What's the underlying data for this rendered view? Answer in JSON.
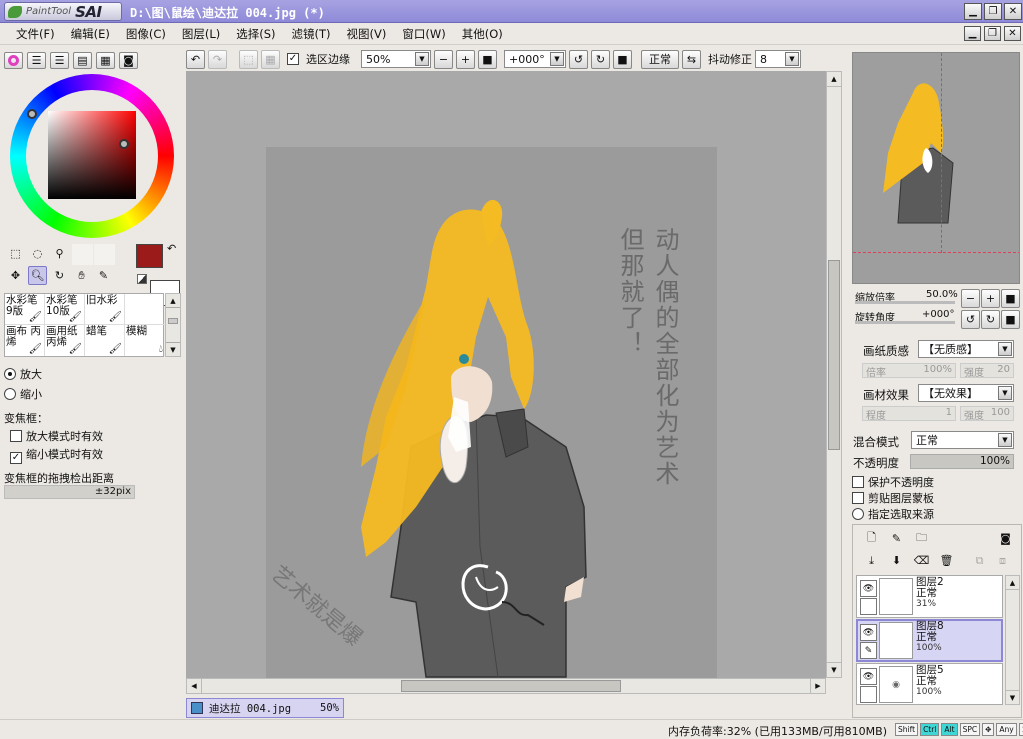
{
  "titlebar": {
    "logo_small": "PaintTool",
    "logo_big": "SAI",
    "document": "D:\\图\\鼠绘\\迪达拉 004.jpg (*)"
  },
  "menu": [
    {
      "label": "文件(F)"
    },
    {
      "label": "编辑(E)"
    },
    {
      "label": "图像(C)"
    },
    {
      "label": "图层(L)"
    },
    {
      "label": "选择(S)"
    },
    {
      "label": "滤镜(T)"
    },
    {
      "label": "视图(V)"
    },
    {
      "label": "窗口(W)"
    },
    {
      "label": "其他(O)"
    }
  ],
  "toolbar": {
    "selection_edge_label": "选区边缘",
    "zoom": "50%",
    "rotation": "+000°",
    "blend": "正常",
    "stabilizer_label": "抖动修正",
    "stabilizer": "8"
  },
  "colors": {
    "primary": "#9b1b1b",
    "secondary": "#ffffff",
    "canvas_bg": "#a9a9a9",
    "paper": "#9b9b9b",
    "hair": "#f5bb22"
  },
  "brushes": [
    {
      "label": "水彩笔 9版"
    },
    {
      "label": "水彩笔 10版"
    },
    {
      "label": "旧水彩"
    },
    {
      "label": ""
    },
    {
      "label": "画布 丙烯"
    },
    {
      "label": "画用纸 丙烯"
    },
    {
      "label": "蜡笔"
    },
    {
      "label": "模糊"
    }
  ],
  "zoom_tool": {
    "zoom_in": "放大",
    "zoom_out": "缩小",
    "frame_label": "变焦框：",
    "opt_in": "放大模式时有效",
    "opt_out": "缩小模式时有效",
    "drag_label": "变焦框的拖拽检出距离",
    "drag_value": "±32pix"
  },
  "artwork_text": {
    "col1": "动人偶的全部化为艺术",
    "col2": "但那就了！",
    "signature": "艺术就是爆"
  },
  "navigator": {
    "zoom_label": "缩放倍率",
    "zoom_value": "50.0%",
    "rotate_label": "旋转角度",
    "rotate_value": "+000°"
  },
  "paper_texture": {
    "label": "画纸质感",
    "value": "【无质感】",
    "rate_label": "倍率",
    "rate": "100%",
    "strength_label": "强度",
    "strength": "20"
  },
  "paper_effect": {
    "label": "画材效果",
    "value": "【无效果】",
    "degree_label": "程度",
    "degree": "1",
    "strength_label": "强度",
    "strength": "100"
  },
  "layer_props": {
    "blend_label": "混合模式",
    "blend_value": "正常",
    "opacity_label": "不透明度",
    "opacity_value": "100%",
    "protect": "保护不透明度",
    "clip": "剪贴图层蒙板",
    "source": "指定选取来源"
  },
  "layers": [
    {
      "name": "图层2",
      "mode": "正常",
      "opacity": "31%"
    },
    {
      "name": "图层8",
      "mode": "正常",
      "opacity": "100%"
    },
    {
      "name": "图层5",
      "mode": "正常",
      "opacity": "100%"
    }
  ],
  "doc_tab": {
    "name": "迪达拉 004.jpg",
    "zoom": "50%"
  },
  "status": {
    "memory": "内存负荷率:32% (已用133MB/可用810MB)",
    "keys": [
      "Shift",
      "Ctrl",
      "Alt",
      "SPC",
      "Any"
    ]
  }
}
